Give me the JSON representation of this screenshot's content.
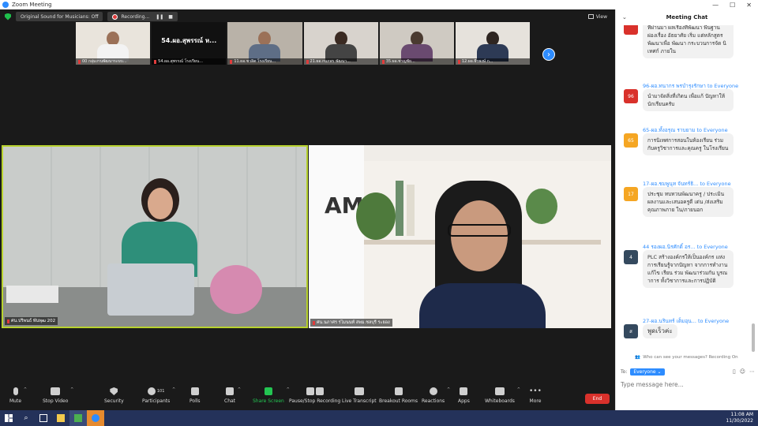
{
  "window": {
    "title": "Zoom Meeting"
  },
  "topbar": {
    "original_sound": "Original Sound for Musicians: Off",
    "recording": "Recording...",
    "view": "View"
  },
  "strip": {
    "tiles": [
      {
        "label": "00 กลุ่มงานพัฒนาระบบ..."
      },
      {
        "label": "54.ผอ.สุพรรณ์ โรงเรียน...",
        "big": "54.ผอ.สุพรรณ์ ห..."
      },
      {
        "label": "11.ผอ.ชวลิต โรงเรียน..."
      },
      {
        "label": "21.ผอ.กนกพร พัฒนา..."
      },
      {
        "label": "35.ผอ.ชาญชัย..."
      },
      {
        "label": "12.ผอ.ธีรพงษ์ ก..."
      }
    ]
  },
  "tiles": {
    "left_name": "ศน.ปริพนธ์ พันพุฒ 202",
    "right_name": "ศน.นภาศร รไมนนท์ สพม.ชลบุรี ระยอง"
  },
  "toolbar": {
    "mute": "Mute",
    "stop_video": "Stop Video",
    "security": "Security",
    "participants": "Participants",
    "participants_count": "101",
    "polls": "Polls",
    "chat": "Chat",
    "share_screen": "Share Screen",
    "pause_stop_recording": "Pause/Stop Recording",
    "live_transcript": "Live Transcript",
    "breakout_rooms": "Breakout Rooms",
    "reactions": "Reactions",
    "apps": "Apps",
    "whiteboards": "Whiteboards",
    "more": "More",
    "end": "End"
  },
  "chat": {
    "title": "Meeting Chat",
    "messages": [
      {
        "sender": "",
        "avatar": "",
        "text": "ที่ผ่านมา ผลเรื่องที่พัฒนา พื้นฐาน ผ่องเรื่อง อัธยาศัย เริ่ม แต่หลักสูตร พัฒนาเพื่อ พัฒนา กระบวนการจัด นิเทศก์ ภายใน",
        "color": "#d9312b"
      },
      {
        "sender": "96-ผอ.ทนากร พรบำรุงรักษา",
        "to": "to Everyone",
        "avatar": "96",
        "text": "นำมาจัดสิ่งที่เกิดน เพื่อแก้ ปัญหาให้นักเรียนครับ",
        "color": "#d9312b"
      },
      {
        "sender": "65-ผอ.ทั้งอรุณ ราบยาม",
        "to": "to Everyone",
        "avatar": "65",
        "text": "การนิเทศการสอนในห้องเรียน ร่วมกับครูวิชาการและคุณครู ในโรงเรียน",
        "color": "#f5a623"
      },
      {
        "sender": "17-ผอ.ชมพูนุท จันทร์ธิ...",
        "to": "to Everyone",
        "avatar": "17",
        "text": "ประชุม ทบทวนพัฒนาครู / ประเมิน ผลงานและเสนอครูดี เด่น /ส่งเสริมคุณภาพภาย ใน/ภายนอก",
        "color": "#f5a623"
      },
      {
        "sender": "44 รองผอ.นิรศักดิ์ อร...",
        "to": "to Everyone",
        "avatar": "4",
        "text": "PLC สร้างองค์กรให้เป็นองค์กร แห่งการเรียนรู้จากปัญหา จากการทำงาน แก้ไข เรียน ร่วม พัฒนาร่วมกัน บูรณาการ ทั้งวิชาการและการปฏิบัติ",
        "color": "#34495e"
      },
      {
        "sender": "27-ผอ.นรินทร์ เต็มอุน...",
        "to": "to Everyone",
        "avatar": "ส",
        "text": "พูดเร็วค่ะ",
        "color": "#34495e"
      }
    ],
    "who_can_see": "Who can see your messages? Recording On",
    "to_label": "To:",
    "to_value": "Everyone",
    "input_placeholder": "Type message here..."
  },
  "taskbar": {
    "time": "11:08 AM",
    "date": "11/30/2022"
  }
}
